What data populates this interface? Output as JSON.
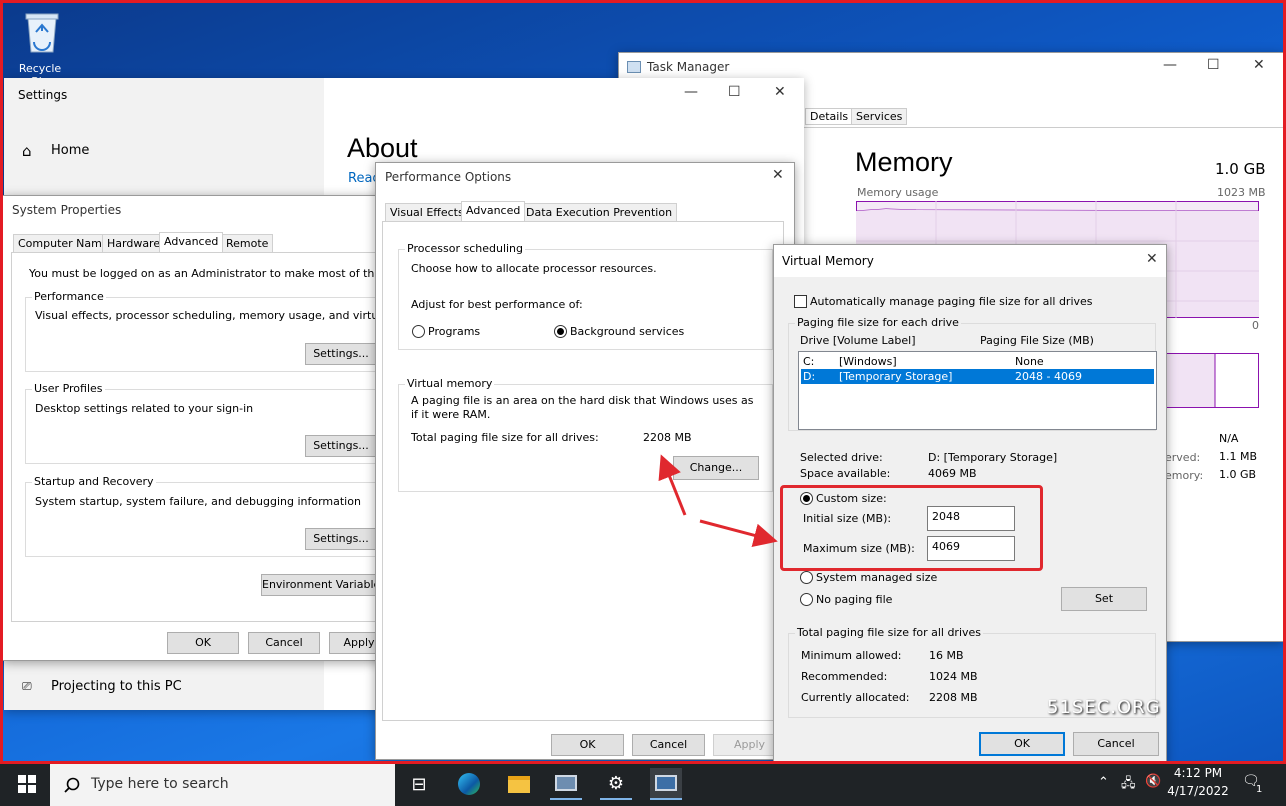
{
  "desktop": {
    "recycle_bin": "Recycle Bin",
    "watermark": "51SEC.ORG"
  },
  "task_manager": {
    "title": "Task Manager",
    "tabs": [
      "Details",
      "Services"
    ],
    "memory_title": "Memory",
    "memory_total": "1.0 GB",
    "memory_usage_label": "Memory usage",
    "memory_max": "1023 MB",
    "axis_zero": "0",
    "na": "N/A",
    "reserved_label": "erved:",
    "reserved_value": "1.1 MB",
    "hw_label": "emory:",
    "hw_value": "1.0 GB"
  },
  "settings": {
    "title": "Settings",
    "home": "Home",
    "about": "About",
    "read": "Reac",
    "projecting": "Projecting to this PC"
  },
  "system_properties": {
    "title": "System Properties",
    "tabs": [
      "Computer Name",
      "Hardware",
      "Advanced",
      "Remote"
    ],
    "admin_note": "You must be logged on as an Administrator to make most of these change",
    "performance": {
      "title": "Performance",
      "desc": "Visual effects, processor scheduling, memory usage, and virtual memory",
      "button": "Settings..."
    },
    "profiles": {
      "title": "User Profiles",
      "desc": "Desktop settings related to your sign-in",
      "button": "Settings..."
    },
    "startup": {
      "title": "Startup and Recovery",
      "desc": "System startup, system failure, and debugging information",
      "button": "Settings..."
    },
    "env_button": "Environment Variables...",
    "ok": "OK",
    "cancel": "Cancel",
    "apply": "Apply"
  },
  "perf_options": {
    "title": "Performance Options",
    "tabs": [
      "Visual Effects",
      "Advanced",
      "Data Execution Prevention"
    ],
    "proc_group": "Processor scheduling",
    "proc_desc": "Choose how to allocate processor resources.",
    "adjust_label": "Adjust for best performance of:",
    "programs": "Programs",
    "background": "Background services",
    "vm_group": "Virtual memory",
    "vm_desc": "A paging file is an area on the hard disk that Windows uses as if it were RAM.",
    "total_label": "Total paging file size for all drives:",
    "total_value": "2208 MB",
    "change_button": "Change...",
    "ok": "OK",
    "cancel": "Cancel",
    "apply": "Apply"
  },
  "virtual_memory": {
    "title": "Virtual Memory",
    "auto_label": "Automatically manage paging file size for all drives",
    "auto_checked": false,
    "group_each": "Paging file size for each drive",
    "col_drive": "Drive  [Volume Label]",
    "col_size": "Paging File Size (MB)",
    "drives": [
      {
        "letter": "C:",
        "label": "[Windows]",
        "size": "None",
        "selected": false
      },
      {
        "letter": "D:",
        "label": "[Temporary Storage]",
        "size": "2048 - 4069",
        "selected": true
      }
    ],
    "selected_drive_label": "Selected drive:",
    "selected_drive_value": "D:  [Temporary Storage]",
    "space_label": "Space available:",
    "space_value": "4069 MB",
    "custom_label": "Custom size:",
    "initial_label": "Initial size (MB):",
    "initial_value": "2048",
    "max_label": "Maximum size (MB):",
    "max_value": "4069",
    "system_managed": "System managed size",
    "no_paging": "No paging file",
    "set_button": "Set",
    "group_total": "Total paging file size for all drives",
    "min_label": "Minimum allowed:",
    "min_value": "16 MB",
    "rec_label": "Recommended:",
    "rec_value": "1024 MB",
    "cur_label": "Currently allocated:",
    "cur_value": "2208 MB",
    "ok": "OK",
    "cancel": "Cancel"
  },
  "taskbar": {
    "search_placeholder": "Type here to search",
    "time": "4:12 PM",
    "date": "4/17/2022",
    "notification_count": "1"
  },
  "colors": {
    "accent": "#0078d7",
    "highlight_red": "#e0282e",
    "taskbar": "#1f2326"
  }
}
